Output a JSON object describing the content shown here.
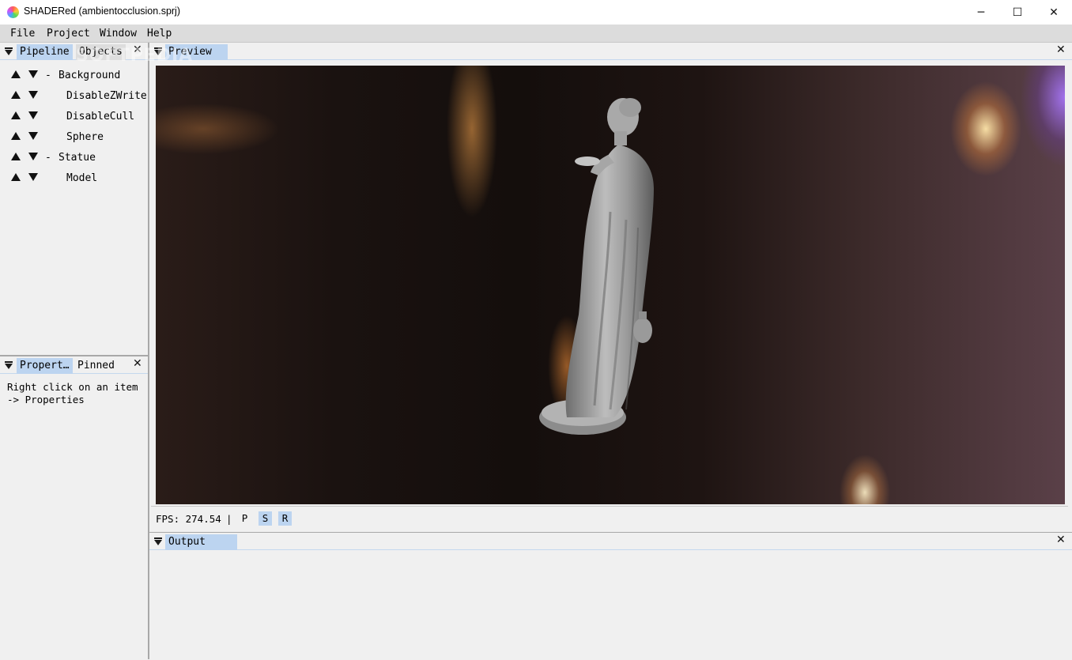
{
  "window": {
    "title": "SHADERed (ambientocclusion.sprj)",
    "minimize_glyph": "─",
    "maximize_glyph": "☐",
    "close_glyph": "✕"
  },
  "menu": [
    "File",
    "Project",
    "Window",
    "Help"
  ],
  "pipeline_panel": {
    "tabs": [
      "Pipeline",
      "Objects"
    ],
    "close_glyph": "✕",
    "items": [
      {
        "prefix": "-",
        "label": "Background"
      },
      {
        "prefix": "",
        "label": "DisableZWrite"
      },
      {
        "prefix": "",
        "label": "DisableCull"
      },
      {
        "prefix": "",
        "label": "Sphere"
      },
      {
        "prefix": "-",
        "label": "Statue"
      },
      {
        "prefix": "",
        "label": "Model"
      }
    ]
  },
  "properties_panel": {
    "tabs": [
      "Propert…",
      "Pinned"
    ],
    "close_glyph": "✕",
    "message": "Right click on an item\n-> Properties"
  },
  "preview_panel": {
    "tab": "Preview",
    "close_glyph": "✕",
    "fps_text": "FPS: 274.54",
    "separator": "|",
    "buttons": [
      {
        "label": "P",
        "active": false
      },
      {
        "label": "S",
        "active": true
      },
      {
        "label": "R",
        "active": true
      }
    ]
  },
  "output_panel": {
    "tab": "Output",
    "close_glyph": "✕"
  },
  "watermark": "SOFTPEDIA",
  "colors": {
    "active_tab": "#bcd4f0",
    "panel_bg": "#f0f0f0",
    "menubar_bg": "#dcdcdc"
  }
}
